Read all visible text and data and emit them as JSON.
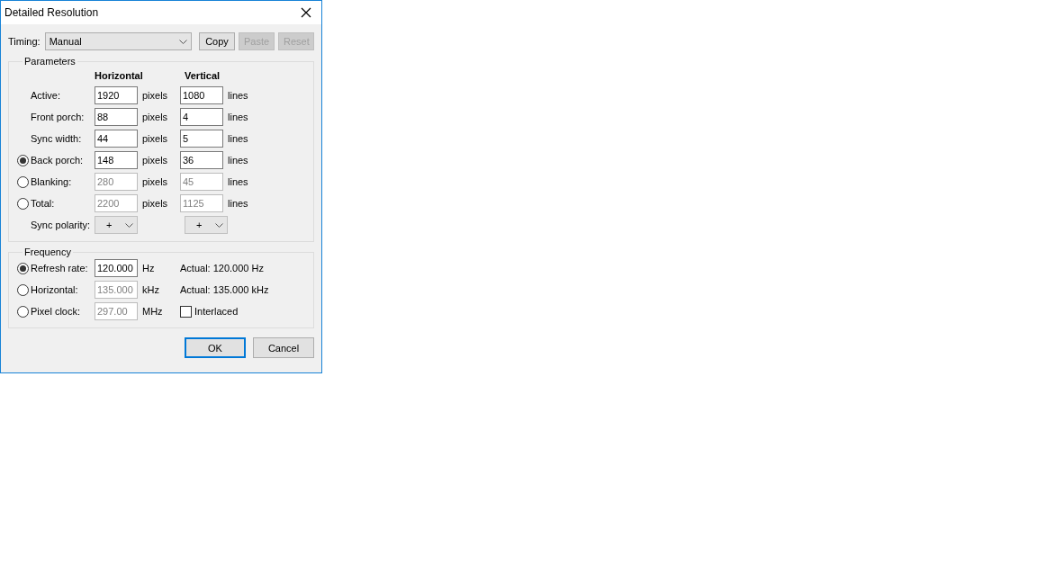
{
  "window": {
    "title": "Detailed Resolution"
  },
  "timing": {
    "label": "Timing:",
    "value": "Manual",
    "buttons": [
      {
        "label": "Copy",
        "disabled": false
      },
      {
        "label": "Paste",
        "disabled": true
      },
      {
        "label": "Reset",
        "disabled": true
      }
    ]
  },
  "parameters": {
    "title": "Parameters",
    "column_headers": [
      "Horizontal",
      "Vertical"
    ],
    "rows": [
      {
        "kind": "plain",
        "label": "Active:",
        "horizontal": {
          "value": "1920",
          "disabled": false,
          "unit": "pixels"
        },
        "vertical": {
          "value": "1080",
          "disabled": false,
          "unit": "lines"
        }
      },
      {
        "kind": "plain",
        "label": "Front porch:",
        "horizontal": {
          "value": "88",
          "disabled": false,
          "unit": "pixels"
        },
        "vertical": {
          "value": "4",
          "disabled": false,
          "unit": "lines"
        }
      },
      {
        "kind": "plain",
        "label": "Sync width:",
        "horizontal": {
          "value": "44",
          "disabled": false,
          "unit": "pixels"
        },
        "vertical": {
          "value": "5",
          "disabled": false,
          "unit": "lines"
        }
      },
      {
        "kind": "radio",
        "label": "Back porch:",
        "selected": true,
        "horizontal": {
          "value": "148",
          "disabled": false,
          "unit": "pixels"
        },
        "vertical": {
          "value": "36",
          "disabled": false,
          "unit": "lines"
        }
      },
      {
        "kind": "radio",
        "label": "Blanking:",
        "selected": false,
        "horizontal": {
          "value": "280",
          "disabled": true,
          "unit": "pixels"
        },
        "vertical": {
          "value": "45",
          "disabled": true,
          "unit": "lines"
        }
      },
      {
        "kind": "radio",
        "label": "Total:",
        "selected": false,
        "horizontal": {
          "value": "2200",
          "disabled": true,
          "unit": "pixels"
        },
        "vertical": {
          "value": "1125",
          "disabled": true,
          "unit": "lines"
        }
      },
      {
        "kind": "dropdown",
        "label": "Sync polarity:",
        "horizontal": {
          "value": "+"
        },
        "vertical": {
          "value": "+"
        }
      }
    ]
  },
  "frequency": {
    "title": "Frequency",
    "rows": [
      {
        "label": "Refresh rate:",
        "selected": true,
        "value": "120.000",
        "disabled": false,
        "unit": "Hz",
        "extra": {
          "kind": "text",
          "text": "Actual: 120.000 Hz"
        }
      },
      {
        "label": "Horizontal:",
        "selected": false,
        "value": "135.000",
        "disabled": true,
        "unit": "kHz",
        "extra": {
          "kind": "text",
          "text": "Actual: 135.000 kHz"
        }
      },
      {
        "label": "Pixel clock:",
        "selected": false,
        "value": "297.00",
        "disabled": true,
        "unit": "MHz",
        "extra": {
          "kind": "checkbox",
          "label": "Interlaced",
          "checked": false
        }
      }
    ]
  },
  "buttons": [
    {
      "label": "OK",
      "default": true
    },
    {
      "label": "Cancel",
      "default": false
    }
  ]
}
